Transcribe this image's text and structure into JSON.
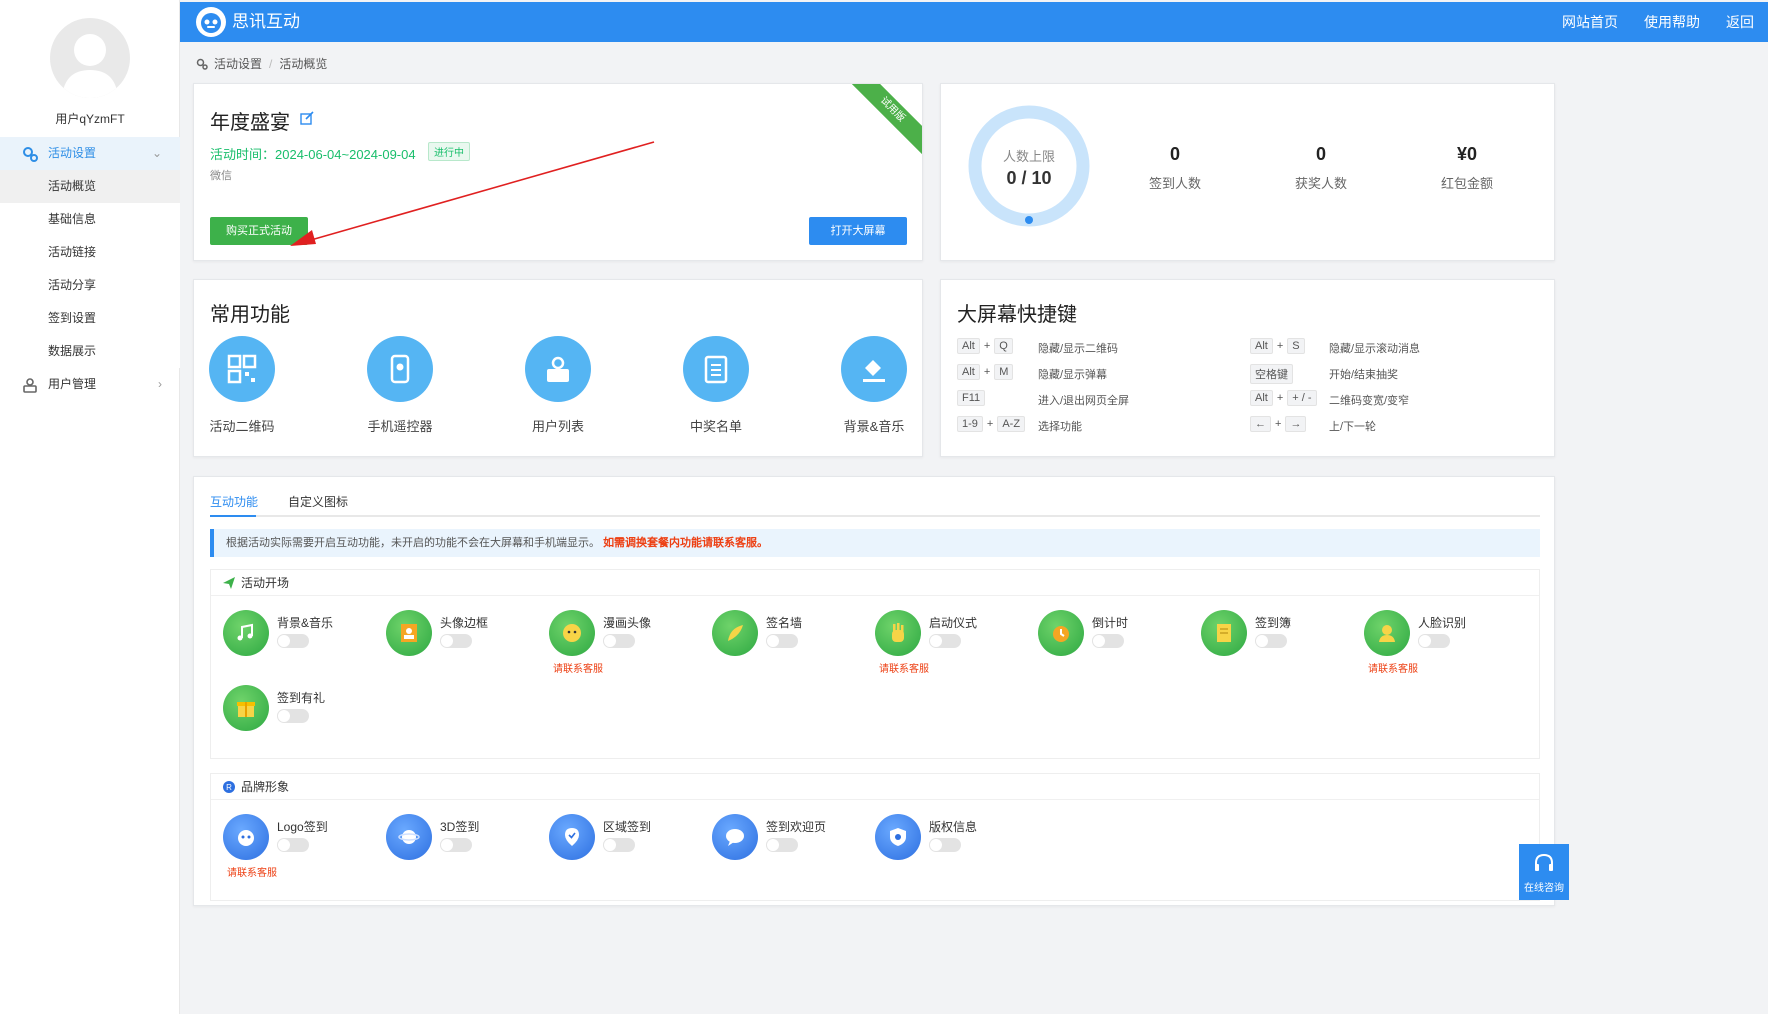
{
  "sidebar": {
    "username": "用户qYzmFT",
    "menu": [
      {
        "label": "活动设置",
        "type": "parent",
        "active": true
      },
      {
        "label": "活动概览",
        "type": "sub",
        "active": true
      },
      {
        "label": "基础信息",
        "type": "sub"
      },
      {
        "label": "活动链接",
        "type": "sub"
      },
      {
        "label": "活动分享",
        "type": "sub"
      },
      {
        "label": "签到设置",
        "type": "sub"
      },
      {
        "label": "数据展示",
        "type": "sub"
      },
      {
        "label": "用户管理",
        "type": "parent"
      }
    ]
  },
  "topbar": {
    "brand": "思讯互动",
    "nav": [
      "网站首页",
      "使用帮助",
      "返回"
    ],
    "color": "#2d8cf0"
  },
  "breadcrumb": [
    "活动设置",
    "活动概览"
  ],
  "event": {
    "title": "年度盛宴",
    "time": "活动时间：2024-06-04~2024-09-04",
    "status": "进行中",
    "platform": "微信",
    "ribbon": "试用版",
    "buy_button": "购买正式活动",
    "screen_button": "打开大屏幕"
  },
  "stats": {
    "limit_label": "人数上限",
    "limit_value": "0 / 10",
    "items": [
      {
        "value": "0",
        "label": "签到人数"
      },
      {
        "value": "0",
        "label": "获奖人数"
      },
      {
        "value": "¥0",
        "label": "红包金额"
      }
    ]
  },
  "common": {
    "title": "常用功能",
    "items": [
      {
        "label": "活动二维码",
        "icon": "qrcode-icon"
      },
      {
        "label": "手机遥控器",
        "icon": "remote-icon"
      },
      {
        "label": "用户列表",
        "icon": "user-list-icon"
      },
      {
        "label": "中奖名单",
        "icon": "winner-list-icon"
      },
      {
        "label": "背景&音乐",
        "icon": "paint-bucket-icon"
      }
    ]
  },
  "shortcuts": {
    "title": "大屏幕快捷键",
    "left": [
      {
        "keys": [
          "Alt",
          "Q"
        ],
        "desc": "隐藏/显示二维码"
      },
      {
        "keys": [
          "Alt",
          "M"
        ],
        "desc": "隐藏/显示弹幕"
      },
      {
        "keys": [
          "F11"
        ],
        "desc": "进入/退出网页全屏"
      },
      {
        "keys": [
          "1-9",
          "A-Z"
        ],
        "desc": "选择功能"
      }
    ],
    "right": [
      {
        "keys": [
          "Alt",
          "S"
        ],
        "desc": "隐藏/显示滚动消息"
      },
      {
        "keys": [
          "空格键"
        ],
        "desc": "开始/结束抽奖"
      },
      {
        "keys": [
          "Alt",
          "+ / -"
        ],
        "desc": "二维码变宽/变窄"
      },
      {
        "keys": [
          "←",
          "→"
        ],
        "desc": "上/下一轮"
      }
    ]
  },
  "tabs": [
    "互动功能",
    "自定义图标"
  ],
  "notice": {
    "text": "根据活动实际需要开启互动功能，未开启的功能不会在大屏幕和手机端显示。",
    "highlight": "如需调换套餐内功能请联系客服。"
  },
  "groups": [
    {
      "title": "活动开场",
      "features": [
        {
          "name": "背景&音乐",
          "contact": ""
        },
        {
          "name": "头像边框",
          "contact": ""
        },
        {
          "name": "漫画头像",
          "contact": "请联系客服"
        },
        {
          "name": "签名墙",
          "contact": ""
        },
        {
          "name": "启动仪式",
          "contact": "请联系客服"
        },
        {
          "name": "倒计时",
          "contact": ""
        },
        {
          "name": "签到簿",
          "contact": ""
        },
        {
          "name": "人脸识别",
          "contact": "请联系客服"
        },
        {
          "name": "签到有礼",
          "contact": ""
        }
      ]
    },
    {
      "title": "品牌形象",
      "features": [
        {
          "name": "Logo签到",
          "contact": "请联系客服"
        },
        {
          "name": "3D签到",
          "contact": ""
        },
        {
          "name": "区域签到",
          "contact": ""
        },
        {
          "name": "签到欢迎页",
          "contact": ""
        },
        {
          "name": "版权信息",
          "contact": ""
        }
      ]
    }
  ],
  "float": {
    "label": "在线咨询"
  }
}
